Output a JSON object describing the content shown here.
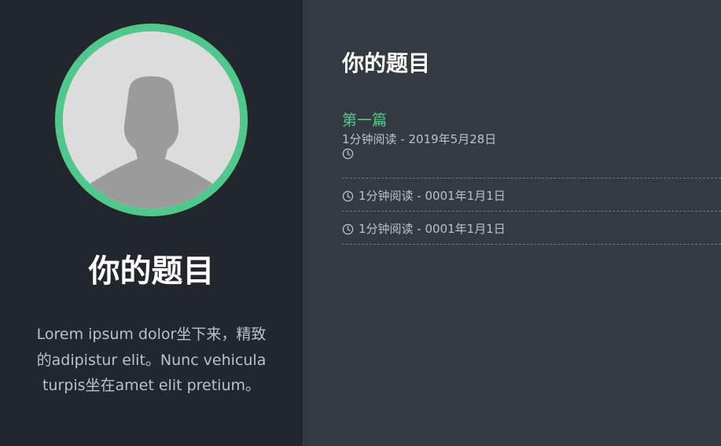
{
  "sidebar": {
    "avatar_icon": "user-silhouette-icon",
    "title": "你的题目",
    "description": "Lorem ipsum dolor坐下来，精致的adipistur elit。Nunc vehicula turpis坐在amet elit pretium。"
  },
  "main": {
    "title": "你的题目",
    "posts": [
      {
        "title": "第一篇",
        "meta": "1分钟阅读 - 2019年5月28日",
        "icon": "clock-icon"
      },
      {
        "meta": "1分钟阅读 - 0001年1月1日",
        "icon": "clock-icon"
      },
      {
        "meta": "1分钟阅读 - 0001年1月1日",
        "icon": "clock-icon"
      }
    ]
  },
  "colors": {
    "sidebar_bg": "#22272e",
    "main_bg": "#343a42",
    "accent": "#50c88c",
    "text_muted": "#b9c1cb",
    "text_heading": "#ffffff"
  }
}
